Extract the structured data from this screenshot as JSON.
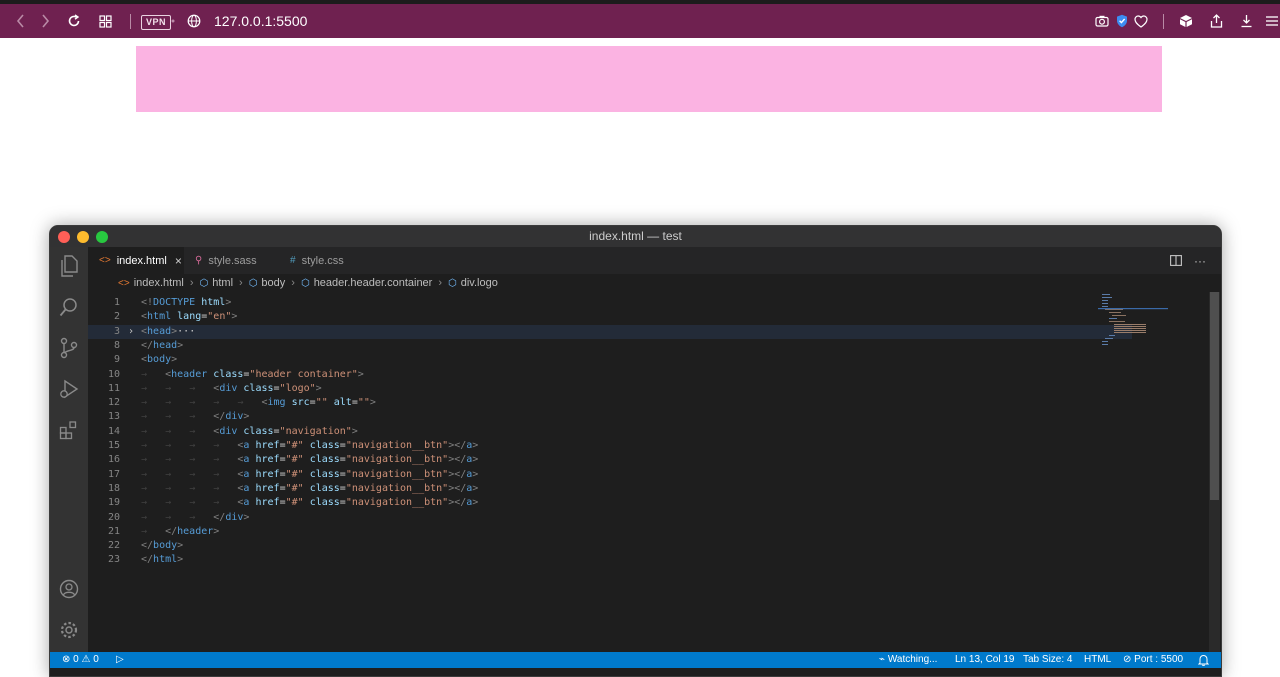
{
  "browser": {
    "vpn_label": "VPN",
    "url": "127.0.0.1:5500",
    "colors": {
      "toolbar": "#6f2150",
      "page_header": "#fbb3e2"
    },
    "icons": [
      "back-icon",
      "forward-icon",
      "reload-icon",
      "tab-grid-icon",
      "globe-icon",
      "camera-icon",
      "shield-icon",
      "heart-icon",
      "cube-icon",
      "share-icon",
      "download-icon",
      "menu-icon"
    ]
  },
  "vscode": {
    "window_title": "index.html — test",
    "tabs": [
      {
        "icon": "<>",
        "label": "index.html",
        "active": true
      },
      {
        "icon": "⚲",
        "label": "style.sass",
        "active": false
      },
      {
        "icon": "#",
        "label": "style.css",
        "active": false
      }
    ],
    "breadcrumb": [
      "index.html",
      "html",
      "body",
      "header.header.container",
      "div.logo"
    ],
    "lines": [
      {
        "n": "1",
        "tokens": [
          [
            "p",
            "<!"
          ],
          [
            "tag",
            "DOCTYPE"
          ],
          [
            "t",
            " "
          ],
          [
            "attr",
            "html"
          ],
          [
            "p",
            ">"
          ]
        ]
      },
      {
        "n": "2",
        "tokens": [
          [
            "p",
            "<"
          ],
          [
            "tag",
            "html"
          ],
          [
            "t",
            " "
          ],
          [
            "attr",
            "lang"
          ],
          [
            "t",
            "="
          ],
          [
            "str",
            "\"en\""
          ],
          [
            "p",
            ">"
          ]
        ]
      },
      {
        "n": "3",
        "fold": true,
        "current": true,
        "tokens": [
          [
            "p",
            "<"
          ],
          [
            "tag",
            "head"
          ],
          [
            "p",
            ">"
          ],
          [
            "t",
            "···"
          ]
        ]
      },
      {
        "n": "8",
        "tokens": [
          [
            "p",
            "</"
          ],
          [
            "tag",
            "head"
          ],
          [
            "p",
            ">"
          ]
        ]
      },
      {
        "n": "9",
        "tokens": [
          [
            "p",
            "<"
          ],
          [
            "tag",
            "body"
          ],
          [
            "p",
            ">"
          ]
        ]
      },
      {
        "n": "10",
        "indent": 1,
        "tokens": [
          [
            "p",
            "<"
          ],
          [
            "tag",
            "header"
          ],
          [
            "t",
            " "
          ],
          [
            "attr",
            "class"
          ],
          [
            "t",
            "="
          ],
          [
            "str",
            "\"header container\""
          ],
          [
            "p",
            ">"
          ]
        ]
      },
      {
        "n": "11",
        "indent": 3,
        "tokens": [
          [
            "p",
            "<"
          ],
          [
            "tag",
            "div"
          ],
          [
            "t",
            " "
          ],
          [
            "attr",
            "class"
          ],
          [
            "t",
            "="
          ],
          [
            "str",
            "\"logo\""
          ],
          [
            "p",
            ">"
          ]
        ]
      },
      {
        "n": "12",
        "indent": 5,
        "tokens": [
          [
            "p",
            "<"
          ],
          [
            "tag",
            "img"
          ],
          [
            "t",
            " "
          ],
          [
            "attr",
            "src"
          ],
          [
            "t",
            "="
          ],
          [
            "str",
            "\"\""
          ],
          [
            "t",
            " "
          ],
          [
            "attr",
            "alt"
          ],
          [
            "t",
            "="
          ],
          [
            "str",
            "\"\""
          ],
          [
            "p",
            ">"
          ]
        ]
      },
      {
        "n": "13",
        "indent": 3,
        "tokens": [
          [
            "p",
            "</"
          ],
          [
            "tag",
            "div"
          ],
          [
            "p",
            ">"
          ]
        ]
      },
      {
        "n": "14",
        "indent": 3,
        "tokens": [
          [
            "p",
            "<"
          ],
          [
            "tag",
            "div"
          ],
          [
            "t",
            " "
          ],
          [
            "attr",
            "class"
          ],
          [
            "t",
            "="
          ],
          [
            "str",
            "\"navigation\""
          ],
          [
            "p",
            ">"
          ]
        ]
      },
      {
        "n": "15",
        "indent": 4,
        "tokens": [
          [
            "p",
            "<"
          ],
          [
            "tag",
            "a"
          ],
          [
            "t",
            " "
          ],
          [
            "attr",
            "href"
          ],
          [
            "t",
            "="
          ],
          [
            "str",
            "\"#\""
          ],
          [
            "t",
            " "
          ],
          [
            "attr",
            "class"
          ],
          [
            "t",
            "="
          ],
          [
            "str",
            "\"navigation__btn\""
          ],
          [
            "p",
            "></"
          ],
          [
            "tag",
            "a"
          ],
          [
            "p",
            ">"
          ]
        ]
      },
      {
        "n": "16",
        "indent": 4,
        "tokens": [
          [
            "p",
            "<"
          ],
          [
            "tag",
            "a"
          ],
          [
            "t",
            " "
          ],
          [
            "attr",
            "href"
          ],
          [
            "t",
            "="
          ],
          [
            "str",
            "\"#\""
          ],
          [
            "t",
            " "
          ],
          [
            "attr",
            "class"
          ],
          [
            "t",
            "="
          ],
          [
            "str",
            "\"navigation__btn\""
          ],
          [
            "p",
            "></"
          ],
          [
            "tag",
            "a"
          ],
          [
            "p",
            ">"
          ]
        ]
      },
      {
        "n": "17",
        "indent": 4,
        "tokens": [
          [
            "p",
            "<"
          ],
          [
            "tag",
            "a"
          ],
          [
            "t",
            " "
          ],
          [
            "attr",
            "href"
          ],
          [
            "t",
            "="
          ],
          [
            "str",
            "\"#\""
          ],
          [
            "t",
            " "
          ],
          [
            "attr",
            "class"
          ],
          [
            "t",
            "="
          ],
          [
            "str",
            "\"navigation__btn\""
          ],
          [
            "p",
            "></"
          ],
          [
            "tag",
            "a"
          ],
          [
            "p",
            ">"
          ]
        ]
      },
      {
        "n": "18",
        "indent": 4,
        "tokens": [
          [
            "p",
            "<"
          ],
          [
            "tag",
            "a"
          ],
          [
            "t",
            " "
          ],
          [
            "attr",
            "href"
          ],
          [
            "t",
            "="
          ],
          [
            "str",
            "\"#\""
          ],
          [
            "t",
            " "
          ],
          [
            "attr",
            "class"
          ],
          [
            "t",
            "="
          ],
          [
            "str",
            "\"navigation__btn\""
          ],
          [
            "p",
            "></"
          ],
          [
            "tag",
            "a"
          ],
          [
            "p",
            ">"
          ]
        ]
      },
      {
        "n": "19",
        "indent": 4,
        "tokens": [
          [
            "p",
            "<"
          ],
          [
            "tag",
            "a"
          ],
          [
            "t",
            " "
          ],
          [
            "attr",
            "href"
          ],
          [
            "t",
            "="
          ],
          [
            "str",
            "\"#\""
          ],
          [
            "t",
            " "
          ],
          [
            "attr",
            "class"
          ],
          [
            "t",
            "="
          ],
          [
            "str",
            "\"navigation__btn\""
          ],
          [
            "p",
            "></"
          ],
          [
            "tag",
            "a"
          ],
          [
            "p",
            ">"
          ]
        ]
      },
      {
        "n": "20",
        "indent": 3,
        "tokens": [
          [
            "p",
            "</"
          ],
          [
            "tag",
            "div"
          ],
          [
            "p",
            ">"
          ]
        ]
      },
      {
        "n": "21",
        "indent": 1,
        "tokens": [
          [
            "p",
            "</"
          ],
          [
            "tag",
            "header"
          ],
          [
            "p",
            ">"
          ]
        ]
      },
      {
        "n": "22",
        "tokens": [
          [
            "p",
            "</"
          ],
          [
            "tag",
            "body"
          ],
          [
            "p",
            ">"
          ]
        ]
      },
      {
        "n": "23",
        "tokens": [
          [
            "p",
            "</"
          ],
          [
            "tag",
            "html"
          ],
          [
            "p",
            ">"
          ]
        ]
      }
    ],
    "status": {
      "problems": "⊗ 0 ⚠ 0",
      "watching": "Watching...",
      "position": "Ln 13, Col 19",
      "tab_size": "Tab Size: 4",
      "language": "HTML",
      "port": "⊘ Port : 5500",
      "color": "#007acc"
    }
  }
}
